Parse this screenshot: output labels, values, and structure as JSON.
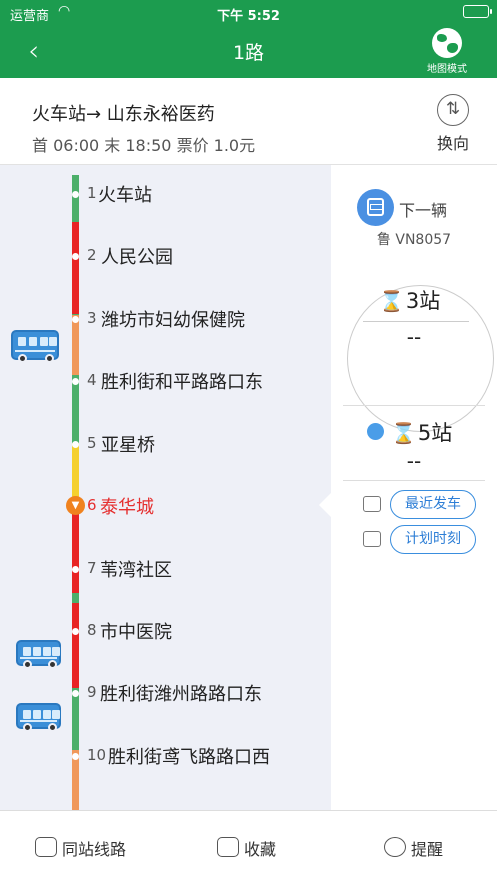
{
  "status_bar": {
    "carrier": "运营商",
    "time": "下午 5:52"
  },
  "nav": {
    "back": "‹",
    "title": "1路",
    "map_mode": "地图模式"
  },
  "route": {
    "direction": "火车站→ 山东永裕医药",
    "schedule": "首 06:00  末 18:50  票价 1.0元",
    "switch_label": "换向",
    "switch_glyph": "⇅"
  },
  "stations": [
    {
      "num": "1",
      "name": "火车站"
    },
    {
      "num": "2",
      "name": "人民公园"
    },
    {
      "num": "3",
      "name": "潍坊市妇幼保健院"
    },
    {
      "num": "4",
      "name": "胜利街和平路路口东"
    },
    {
      "num": "5",
      "name": "亚星桥"
    },
    {
      "num": "6",
      "name": "泰华城",
      "current": true
    },
    {
      "num": "7",
      "name": "苇湾社区"
    },
    {
      "num": "8",
      "name": "市中医院"
    },
    {
      "num": "9",
      "name": "胜利街潍州路路口东"
    },
    {
      "num": "10",
      "name": "胜利街鸢飞路路口西"
    }
  ],
  "segment_colors": {
    "green": "#4caf6a",
    "red": "#e82424",
    "orange": "#f0985a",
    "yellow": "#f5d02e"
  },
  "next_bus": {
    "label": "下一辆",
    "plate": "鲁 VN8057",
    "stops": "3站",
    "eta": "--"
  },
  "second_bus": {
    "stops": "5站",
    "eta": "--"
  },
  "actions": {
    "recent": "最近发车",
    "timetable": "计划时刻"
  },
  "tabs": {
    "same_station": "同站线路",
    "favorite": "收藏",
    "remind": "提醒"
  }
}
